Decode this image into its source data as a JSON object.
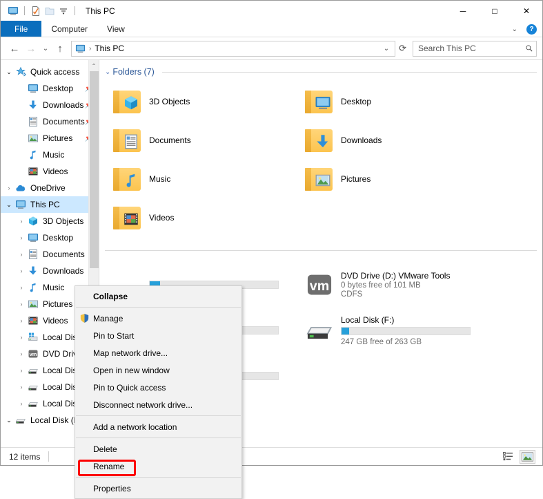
{
  "window": {
    "title": "This PC",
    "minimize": "─",
    "maximize": "□",
    "close": "✕"
  },
  "quick_access_toolbar": {
    "items": [
      {
        "name": "this-pc-icon",
        "label": "This PC"
      },
      {
        "name": "properties-icon",
        "label": "Properties"
      },
      {
        "name": "new-folder-icon",
        "label": "New folder"
      },
      {
        "name": "customize-dropdown-icon",
        "label": "Customize Quick Access Toolbar"
      }
    ]
  },
  "ribbon": {
    "tabs": [
      {
        "label": "File",
        "active": true
      },
      {
        "label": "Computer",
        "active": false
      },
      {
        "label": "View",
        "active": false
      }
    ],
    "collapse_chevron": "⌄",
    "help_label": "?"
  },
  "addressbar": {
    "back": "←",
    "forward": "→",
    "recent": "⌄",
    "up": "↑",
    "crumb_icon": "this-pc-icon",
    "crumb_text": "This PC",
    "crumb_sep": "›",
    "dropdown": "⌄",
    "refresh": "⟳",
    "search_placeholder": "Search This PC",
    "search_value": "",
    "search_icon": "🔎"
  },
  "navigation_pane": {
    "scroll_up": "⌃",
    "scroll_down": "⌄",
    "tree": [
      {
        "label": "Quick access",
        "icon": "star-icon",
        "twisty": "open",
        "indent": 1,
        "pinned": false,
        "selected": false
      },
      {
        "label": "Desktop",
        "icon": "desktop-icon",
        "twisty": "none",
        "indent": 2,
        "pinned": true,
        "selected": false
      },
      {
        "label": "Downloads",
        "icon": "downloads-icon",
        "twisty": "none",
        "indent": 2,
        "pinned": true,
        "selected": false
      },
      {
        "label": "Documents",
        "icon": "documents-icon",
        "twisty": "none",
        "indent": 2,
        "pinned": true,
        "selected": false
      },
      {
        "label": "Pictures",
        "icon": "pictures-icon",
        "twisty": "none",
        "indent": 2,
        "pinned": true,
        "selected": false
      },
      {
        "label": "Music",
        "icon": "music-icon",
        "twisty": "none",
        "indent": 2,
        "pinned": false,
        "selected": false
      },
      {
        "label": "Videos",
        "icon": "videos-icon",
        "twisty": "none",
        "indent": 2,
        "pinned": false,
        "selected": false
      },
      {
        "label": "OneDrive",
        "icon": "onedrive-icon",
        "twisty": "closed",
        "indent": 1,
        "pinned": false,
        "selected": false
      },
      {
        "label": "This PC",
        "icon": "this-pc-icon",
        "twisty": "open",
        "indent": 1,
        "pinned": false,
        "selected": true
      },
      {
        "label": "3D Objects",
        "icon": "3d-objects-icon",
        "twisty": "closed",
        "indent": 2,
        "pinned": false,
        "selected": false
      },
      {
        "label": "Desktop",
        "icon": "desktop-icon",
        "twisty": "closed",
        "indent": 2,
        "pinned": false,
        "selected": false
      },
      {
        "label": "Documents",
        "icon": "documents-icon",
        "twisty": "closed",
        "indent": 2,
        "pinned": false,
        "selected": false
      },
      {
        "label": "Downloads",
        "icon": "downloads-icon",
        "twisty": "closed",
        "indent": 2,
        "pinned": false,
        "selected": false
      },
      {
        "label": "Music",
        "icon": "music-icon",
        "twisty": "closed",
        "indent": 2,
        "pinned": false,
        "selected": false
      },
      {
        "label": "Pictures",
        "icon": "pictures-icon",
        "twisty": "closed",
        "indent": 2,
        "pinned": false,
        "selected": false
      },
      {
        "label": "Videos",
        "icon": "videos-icon",
        "twisty": "closed",
        "indent": 2,
        "pinned": false,
        "selected": false
      },
      {
        "label": "Local Disk (C:)",
        "icon": "windows-drive-icon",
        "twisty": "closed",
        "indent": 2,
        "pinned": false,
        "selected": false
      },
      {
        "label": "DVD Drive (D:)",
        "icon": "vmware-dvd-icon",
        "twisty": "closed",
        "indent": 2,
        "pinned": false,
        "selected": false
      },
      {
        "label": "Local Disk (E:)",
        "icon": "drive-icon",
        "twisty": "closed",
        "indent": 2,
        "pinned": false,
        "selected": false
      },
      {
        "label": "Local Disk (F:)",
        "icon": "drive-icon",
        "twisty": "closed",
        "indent": 2,
        "pinned": false,
        "selected": false
      },
      {
        "label": "Local Disk (G:)",
        "icon": "drive-icon",
        "twisty": "closed",
        "indent": 2,
        "pinned": false,
        "selected": false
      },
      {
        "label": "Local Disk (F:)",
        "icon": "drive-icon",
        "twisty": "open",
        "indent": 1,
        "pinned": false,
        "selected": false
      }
    ]
  },
  "filelist": {
    "groups": [
      {
        "name": "folders-group",
        "chevron": "⌄",
        "title": "Folders (7)",
        "items": [
          {
            "name": "3D Objects",
            "icon": "3d-objects-icon"
          },
          {
            "name": "Desktop",
            "icon": "desktop-icon"
          },
          {
            "name": "Documents",
            "icon": "documents-icon"
          },
          {
            "name": "Downloads",
            "icon": "downloads-icon"
          },
          {
            "name": "Music",
            "icon": "music-icon"
          },
          {
            "name": "Pictures",
            "icon": "pictures-icon"
          },
          {
            "name": "Videos",
            "icon": "videos-icon"
          }
        ]
      },
      {
        "name": "devices-group",
        "chevron": "",
        "title": "",
        "drives": [
          {
            "name": "DVD Drive (D:) VMware Tools",
            "icon": "vmware-dvd-icon",
            "free": "0 bytes free of 101 MB",
            "fs": "CDFS",
            "bar": null
          },
          {
            "name": "Local Disk (F:)",
            "icon": "drive-icon",
            "free": "247 GB free of 263 GB",
            "fs": "",
            "bar": 6,
            "bar_color": "#26a0da"
          }
        ]
      }
    ]
  },
  "context_menu": {
    "items": [
      {
        "label": "Collapse",
        "bold": true,
        "icon": null
      },
      {
        "separator": true
      },
      {
        "label": "Manage",
        "bold": false,
        "icon": "shield-icon"
      },
      {
        "label": "Pin to Start",
        "bold": false,
        "icon": null
      },
      {
        "label": "Map network drive...",
        "bold": false,
        "icon": null
      },
      {
        "label": "Open in new window",
        "bold": false,
        "icon": null
      },
      {
        "label": "Pin to Quick access",
        "bold": false,
        "icon": null
      },
      {
        "label": "Disconnect network drive...",
        "bold": false,
        "icon": null
      },
      {
        "separator": true
      },
      {
        "label": "Add a network location",
        "bold": false,
        "icon": null
      },
      {
        "separator": true
      },
      {
        "label": "Delete",
        "bold": false,
        "icon": null
      },
      {
        "label": "Rename",
        "bold": false,
        "icon": null
      },
      {
        "separator": true
      },
      {
        "label": "Properties",
        "bold": false,
        "icon": null,
        "highlighted": true
      }
    ],
    "highlight_color": "#fc0000"
  },
  "statusbar": {
    "item_count": "12 items",
    "view_details_icon": "details-view-icon",
    "view_large_icon": "large-icons-view-icon"
  }
}
